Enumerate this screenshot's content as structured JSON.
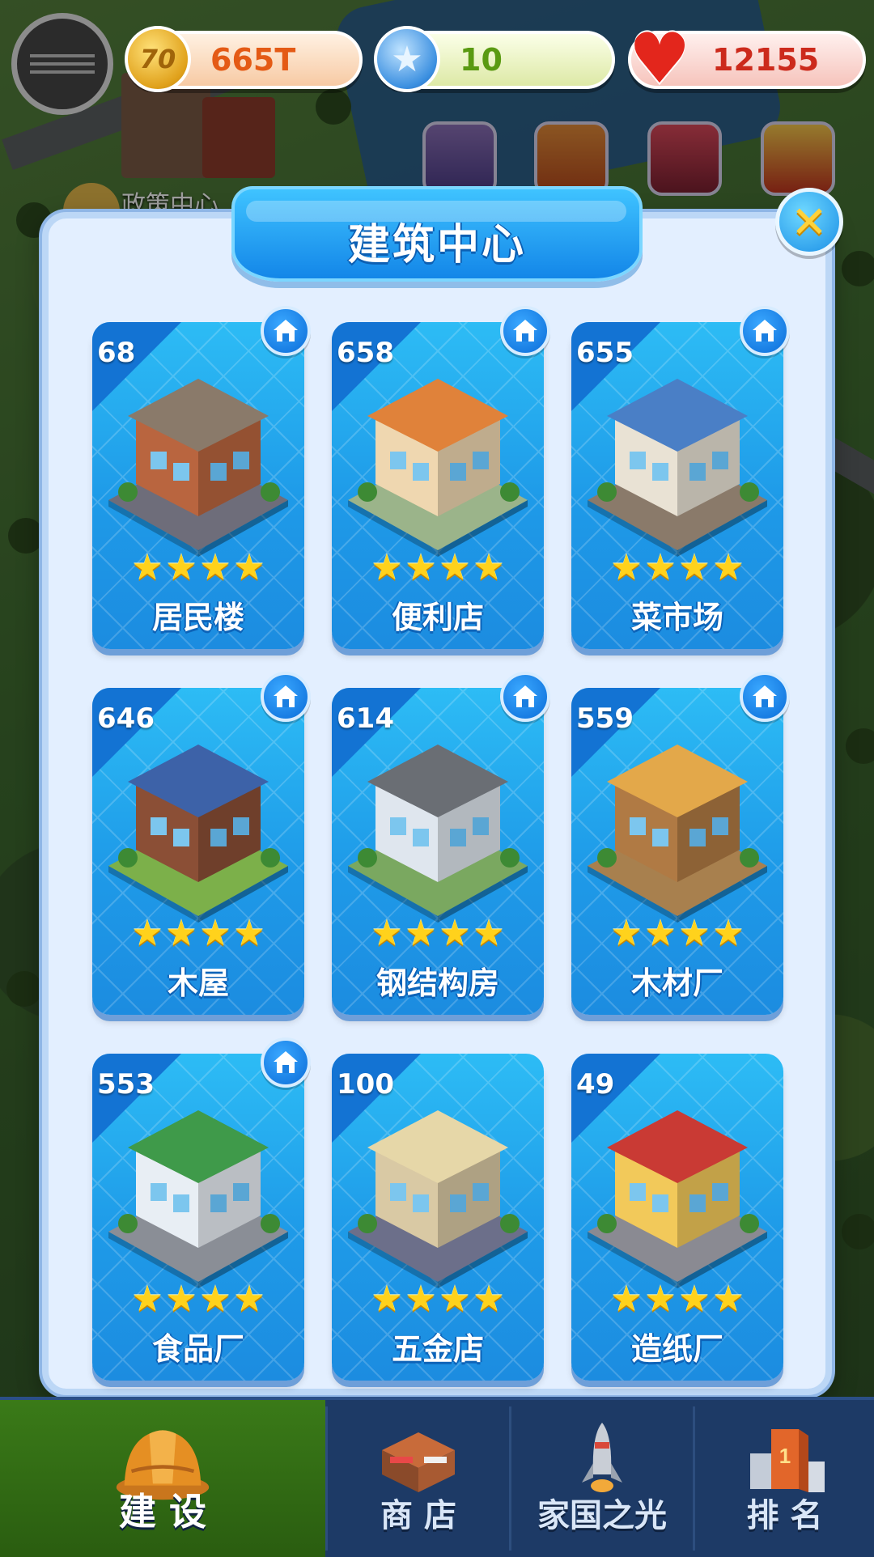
{
  "resources": {
    "coins": "665T",
    "stars": "10",
    "hearts": "12155"
  },
  "background": {
    "policy_center_label": "政策中心"
  },
  "dialog": {
    "title": "建筑中心"
  },
  "buildings": [
    {
      "count": "68",
      "name": "居民楼",
      "stars": 4,
      "has_home_badge": true
    },
    {
      "count": "658",
      "name": "便利店",
      "stars": 4,
      "has_home_badge": true
    },
    {
      "count": "655",
      "name": "菜市场",
      "stars": 4,
      "has_home_badge": true
    },
    {
      "count": "646",
      "name": "木屋",
      "stars": 4,
      "has_home_badge": true
    },
    {
      "count": "614",
      "name": "钢结构房",
      "stars": 4,
      "has_home_badge": true
    },
    {
      "count": "559",
      "name": "木材厂",
      "stars": 4,
      "has_home_badge": true
    },
    {
      "count": "553",
      "name": "食品厂",
      "stars": 4,
      "has_home_badge": true
    },
    {
      "count": "100",
      "name": "五金店",
      "stars": 4,
      "has_home_badge": false
    },
    {
      "count": "49",
      "name": "造纸厂",
      "stars": 4,
      "has_home_badge": false
    }
  ],
  "bottom_nav": [
    {
      "label": "建 设",
      "active": true,
      "icon": "hard-hat-icon"
    },
    {
      "label": "商 店",
      "active": false,
      "icon": "shop-icon"
    },
    {
      "label": "家国之光",
      "active": false,
      "icon": "rocket-icon"
    },
    {
      "label": "排 名",
      "active": false,
      "icon": "ranking-podium-icon"
    }
  ],
  "colors": {
    "card_blue": "#1e9ae8",
    "title_blue": "#1386e8",
    "star_gold": "#ffd21c",
    "close_yellow": "#ffd23a",
    "active_tab_green": "#3a7a18"
  }
}
